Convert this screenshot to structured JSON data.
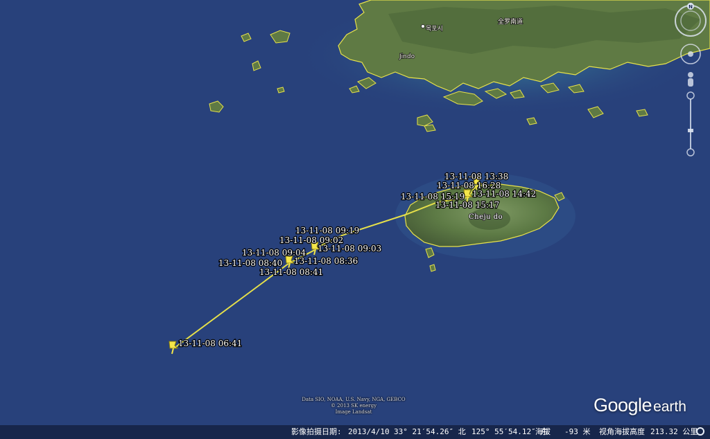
{
  "map": {
    "colors": {
      "ocean": "#2a447f",
      "land": "#5f7a44",
      "coast_outline": "#e8e24a",
      "track_line": "#e6e04a",
      "pin": "#f4e64a",
      "shallow_water": "#3a8a9c"
    },
    "place_labels": {
      "mokpo": "목포시",
      "jeonnam": "全罗南道",
      "jindo": "Jindo",
      "cheju": "Cheju do"
    },
    "track_points": [
      {
        "id": "p0641",
        "label": "13-11-08 06:41"
      },
      {
        "id": "p0841",
        "label": "13-11-08 08:41"
      },
      {
        "id": "p0840",
        "label": "13-11-08 08:40"
      },
      {
        "id": "p0836",
        "label": "13-11-08 08:36"
      },
      {
        "id": "p0904",
        "label": "13-11-08 09:04"
      },
      {
        "id": "p0903",
        "label": "13-11-08 09:03"
      },
      {
        "id": "p0902",
        "label": "13-11-08 09:02"
      },
      {
        "id": "p0919",
        "label": "13-11-08 09:19"
      },
      {
        "id": "p1517",
        "label": "13-11-08 15:17"
      },
      {
        "id": "p1519",
        "label": "13-11-08 15:19"
      },
      {
        "id": "p1442",
        "label": "13-11-08 14:42"
      },
      {
        "id": "p1628",
        "label": "13-11-08 16:28"
      },
      {
        "id": "p1338",
        "label": "13-11-08 13:38"
      }
    ]
  },
  "attribution": {
    "line1": "Data SIO, NOAA, U.S. Navy, NGA, GEBCO",
    "line2": "© 2013 SK energy",
    "line3": "Image Landsat"
  },
  "logo": {
    "brand": "Google",
    "product": "earth"
  },
  "status_bar": {
    "imagery_date_label": "影像拍摄日期:",
    "imagery_date": "2013/4/10",
    "latitude": "33° 21′54.26″ 北",
    "longitude": "125° 55′54.12″ 东",
    "elevation_label": "海拔",
    "elevation": "-93 米",
    "eye_alt_label": "视角海拔高度",
    "eye_alt": "213.32 公里"
  },
  "nav_icons": {
    "north": "N",
    "compass": "compass-icon",
    "look": "look-joystick-icon",
    "move": "move-joystick-icon",
    "street_view": "pegman-icon",
    "zoom": "zoom-slider-icon"
  }
}
